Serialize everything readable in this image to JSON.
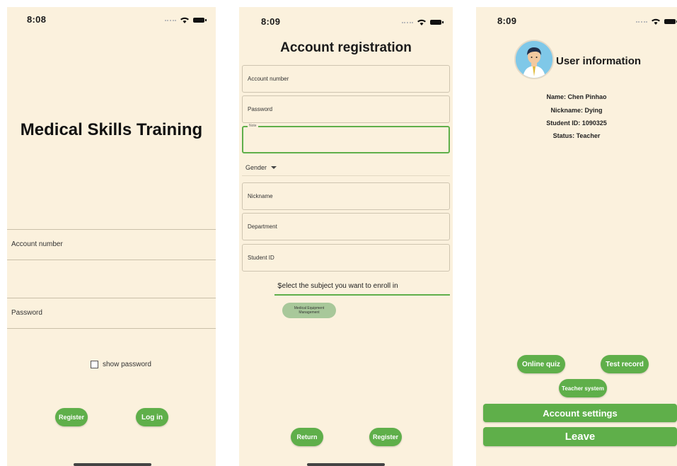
{
  "screens": {
    "login": {
      "time": "8:08",
      "title": "Medical Skills Training",
      "account_placeholder": "Account number",
      "password_placeholder": "Password",
      "show_password": "show password",
      "register": "Register",
      "login": "Log in"
    },
    "registration": {
      "time": "8:09",
      "title": "Account registration",
      "account_placeholder": "Account number",
      "password_placeholder": "Password",
      "note_label": "Note",
      "gender": "Gender",
      "nickname_placeholder": "Nickname",
      "department_placeholder": "Department",
      "student_id_placeholder": "Student ID",
      "subject_prompt": "Select the subject you want to enroll in",
      "subject_chip_line1": "Medical Equipment",
      "subject_chip_line2": "Management",
      "return": "Return",
      "register": "Register"
    },
    "user_info": {
      "time": "8:09",
      "title": "User information",
      "name": "Name: Chen Pinhao",
      "nickname": "Nickname: Dying",
      "student_id": "Student ID: 1090325",
      "status": "Status: Teacher",
      "online_quiz": "Online quiz",
      "test_record": "Test record",
      "teacher_system": "Teacher system",
      "account_settings": "Account settings",
      "leave": "Leave"
    }
  },
  "colors": {
    "background": "#fbf1dd",
    "accent": "#5faf4a",
    "chip": "#a8c89a"
  }
}
